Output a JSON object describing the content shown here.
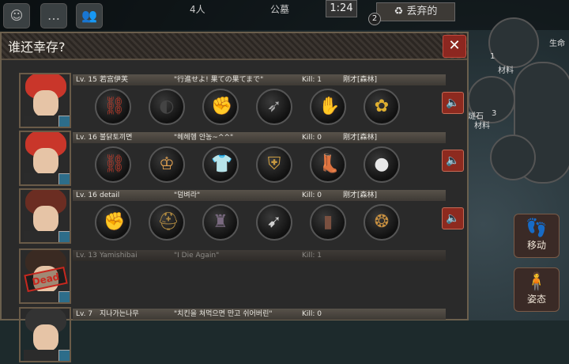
{
  "hud": {
    "player_count": "4人",
    "location": "公墓",
    "timer": "1:24",
    "discard_label": "丢弃的",
    "discard_badge": "2",
    "right_material_1": "材料",
    "right_material_1_count": "1",
    "right_material_2": "材料",
    "right_material_2_prefix": "燧石",
    "right_material_2_count": "3",
    "right_side_label": "生命",
    "move_button": "移动",
    "stance_button": "姿态"
  },
  "dialog": {
    "title": "谁还幸存?",
    "close_icon": "close-icon",
    "players": [
      {
        "level": "Lv. 15",
        "name": "若宫伊芙",
        "quote": "\"行進せよ! 果ての果てまで\"",
        "kill": "Kill: 1",
        "team": "刚才[森林]",
        "hair_color": "#c9362a",
        "items": [
          "brass-knuckles-icon",
          "eyepatch-icon",
          "gauntlet-icon",
          "spiked-club-icon",
          "claw-glove-icon",
          "flower-icon"
        ]
      },
      {
        "level": "Lv. 16",
        "name": "불닭토끼면",
        "quote": "\"헤헤헹 안농~^^\"",
        "kill": "Kill: 0",
        "team": "刚才[森林]",
        "hair_color": "#c9362a",
        "items": [
          "brass-knuckles-icon",
          "winged-tiara-icon",
          "shirt-icon",
          "shield-icon",
          "boots-icon",
          "pearl-icon"
        ]
      },
      {
        "level": "Lv. 16",
        "name": "detail",
        "quote": "\"덤벼라\"",
        "kill": "Kill: 0",
        "team": "刚才[森林]",
        "hair_color": "#6b2d22",
        "items": [
          "gauntlet-icon",
          "helmet-icon",
          "armor-icon",
          "feather-icon",
          "bracer-icon",
          "earrings-icon"
        ]
      },
      {
        "level": "Lv. 13",
        "name": "Yamishibai",
        "quote": "\"I Die Again\"",
        "kill": "Kill: 1",
        "team": "",
        "hair_color": "#3a2a22",
        "dead": "Dead"
      },
      {
        "level": "Lv. 7",
        "name": "지나가는나무",
        "quote": "\"치킨을 쳐먹으면 만고 쉬어버린\"",
        "kill": "Kill: 0",
        "team": "",
        "hair_color": "#333"
      }
    ]
  }
}
